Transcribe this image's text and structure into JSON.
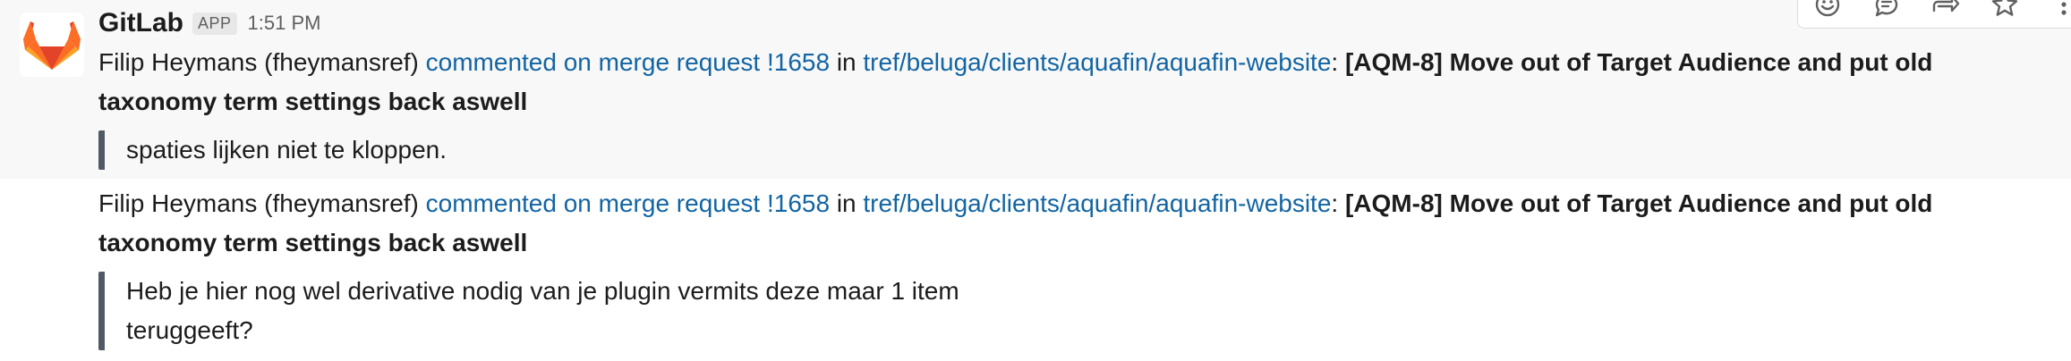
{
  "app": {
    "sender": "GitLab",
    "badge": "APP",
    "time": "1:51 PM"
  },
  "messages": [
    {
      "author": "Filip Heymans (fheymansref) ",
      "action": "commented on merge request !1658",
      "in": " in ",
      "repo": "tref/beluga/clients/aquafin/aquafin-website",
      "colon": ": ",
      "title_line1": "[AQM-8] Move out of Target Audience and put old",
      "title_line2": "taxonomy term settings back aswell",
      "quote_line1": "spaties lijken niet te kloppen.",
      "quote_line2": ""
    },
    {
      "author": "Filip Heymans (fheymansref) ",
      "action": "commented on merge request !1658",
      "in": " in ",
      "repo": "tref/beluga/clients/aquafin/aquafin-website",
      "colon": ": ",
      "title_line1": "[AQM-8] Move out of Target Audience and put old",
      "title_line2": "taxonomy term settings back aswell",
      "quote_line1": "Heb je hier nog wel derivative nodig van je plugin vermits deze maar 1 item",
      "quote_line2": "teruggeeft?"
    }
  ],
  "toolbar": {
    "icons": [
      "emoji-icon",
      "thread-reply-icon",
      "share-icon",
      "star-icon",
      "more-icon"
    ]
  },
  "colors": {
    "link": "#1264a3",
    "quote_bar": "#505a66",
    "hover_bg": "#f8f8f8"
  }
}
